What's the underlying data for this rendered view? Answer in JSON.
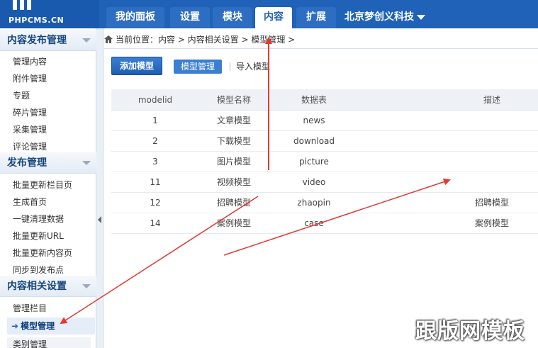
{
  "logo": {
    "mark": "PC",
    "sub": "PHPCMS.CN"
  },
  "top_tabs": [
    {
      "label": "我的面板"
    },
    {
      "label": "设置"
    },
    {
      "label": "模块"
    },
    {
      "label": "内容"
    },
    {
      "label": "扩展"
    }
  ],
  "active_top_tab": "内容",
  "site_menu": {
    "label": "北京梦创义科技"
  },
  "sidebar": {
    "sections": [
      {
        "title": "内容发布管理",
        "items": [
          "管理内容",
          "附件管理",
          "专题",
          "碎片管理",
          "采集管理",
          "评论管理"
        ]
      },
      {
        "title": "发布管理",
        "items": [
          "批量更新栏目页",
          "生成首页",
          "一键清理数据",
          "批量更新URL",
          "批量更新内容页",
          "同步到发布点"
        ]
      },
      {
        "title": "内容相关设置",
        "items": [
          "管理栏目",
          "模型管理",
          "类别管理"
        ]
      }
    ],
    "active_item": "模型管理"
  },
  "breadcrumb": {
    "text": "当前位置：内容 > 内容相关设置 > 模型管理 >"
  },
  "toolbar": {
    "add_label": "添加模型",
    "manage_label": "模型管理",
    "import_label": "导入模型"
  },
  "table": {
    "headers": [
      "modelid",
      "模型名称",
      "数据表",
      "描述"
    ],
    "rows": [
      {
        "id": "1",
        "name": "文章模型",
        "table": "news",
        "desc": ""
      },
      {
        "id": "2",
        "name": "下载模型",
        "table": "download",
        "desc": ""
      },
      {
        "id": "3",
        "name": "图片模型",
        "table": "picture",
        "desc": ""
      },
      {
        "id": "11",
        "name": "视频模型",
        "table": "video",
        "desc": ""
      },
      {
        "id": "12",
        "name": "招聘模型",
        "table": "zhaopin",
        "desc": "招聘模型"
      },
      {
        "id": "14",
        "name": "案例模型",
        "table": "case",
        "desc": "案例模型"
      }
    ]
  },
  "watermark": "跟版网模板",
  "colors": {
    "topbar": "#1f62b8",
    "accent": "#3b7fd2",
    "arrow": "#e03a33"
  }
}
